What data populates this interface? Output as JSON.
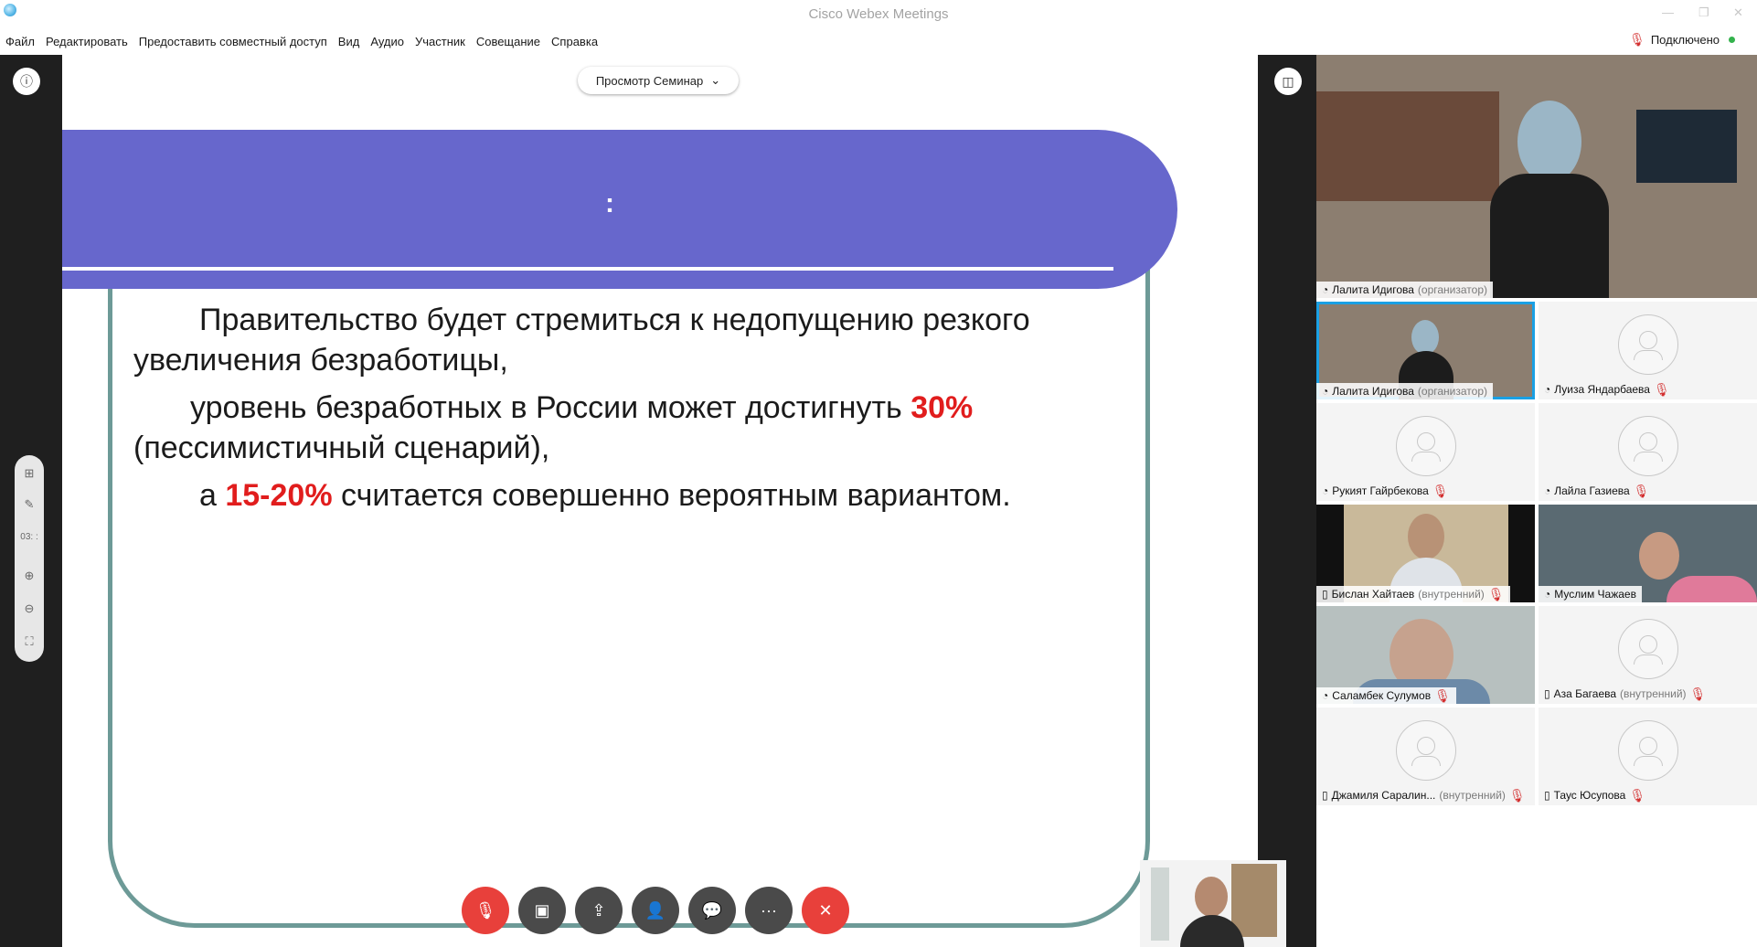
{
  "window": {
    "title": "Cisco Webex Meetings"
  },
  "menu": [
    "Файл",
    "Редактировать",
    "Предоставить совместный доступ",
    "Вид",
    "Аудио",
    "Участник",
    "Совещание",
    "Справка"
  ],
  "status": {
    "label": "Подключено"
  },
  "slide": {
    "view_dropdown": "Просмотр Семинар",
    "banner_text": ":",
    "line1": "Правительство будет стремиться к недопущению резкого увеличения безработицы,",
    "line2_pre": "уровень безработных в России может достигнуть ",
    "line2_highlight": "30%",
    "line2_post": " (пессимистичный сценарий),",
    "line3_pre": "а ",
    "line3_highlight": "15-20%",
    "line3_post": " считается совершенно вероятным вариантом."
  },
  "tools": {
    "timer": "03: :"
  },
  "participants": {
    "main": {
      "name": "Лалита Идигова",
      "role": "(организатор)"
    },
    "tiles": [
      {
        "name": "Лалита Идигова",
        "role": "(организатор)"
      },
      {
        "name": "Луиза Яндарбаева",
        "role": ""
      },
      {
        "name": "Рукият Гайрбекова",
        "role": ""
      },
      {
        "name": "Лайла Газиева",
        "role": ""
      },
      {
        "name": "Бислан Хайтаев",
        "role": "(внутренний)"
      },
      {
        "name": "Муслим Чажаев",
        "role": ""
      },
      {
        "name": "Саламбек Сулумов",
        "role": ""
      },
      {
        "name": "Аза Багаева",
        "role": "(внутренний)"
      },
      {
        "name": "Джамиля Саралин...",
        "role": "(внутренний)"
      },
      {
        "name": "Таус Юсупова",
        "role": ""
      }
    ]
  },
  "colors": {
    "banner": "#6767cc",
    "frame": "#6d9a97",
    "highlight_text": "#e11d1d",
    "leave_button": "#e8403b",
    "active_border": "#1aa0e4"
  }
}
